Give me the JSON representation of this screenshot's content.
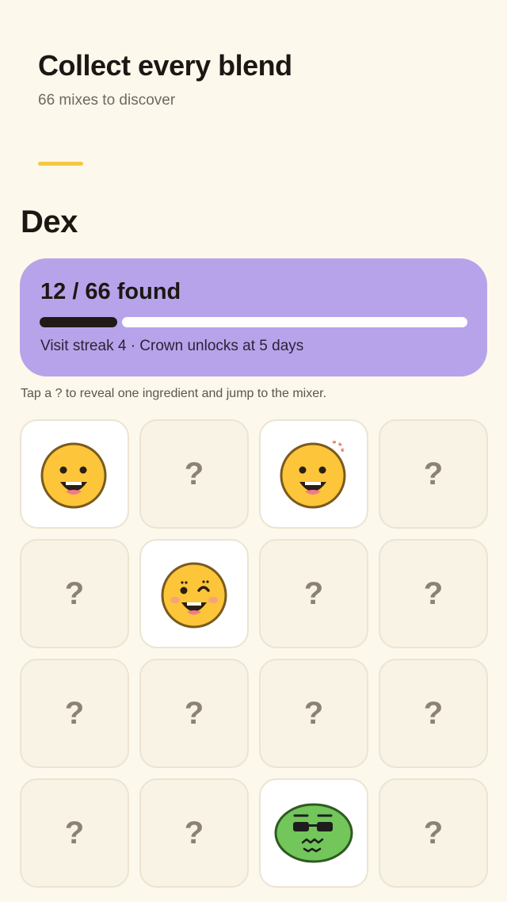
{
  "header": {
    "title": "Collect every blend",
    "subtitle": "66 mixes to discover"
  },
  "section": {
    "title": "Dex"
  },
  "progress": {
    "label": "12 / 66 found",
    "found": 12,
    "total": 66,
    "streak_text": "Visit streak 4 · Crown unlocks at 5 days"
  },
  "hint": "Tap a ? to reveal one ingredient and jump to the mixer.",
  "colors": {
    "background": "#fdf8ec",
    "accent": "#f5c842",
    "card": "#b7a3ea",
    "tile_locked": "#f9f3e6",
    "tile_found": "#ffffff",
    "face_yellow": "#fcc53a",
    "face_green": "#72c65a"
  },
  "tiles": [
    {
      "state": "found",
      "icon": "grinning-face-icon"
    },
    {
      "state": "locked",
      "label": "?"
    },
    {
      "state": "found",
      "icon": "grinning-face-sparkle-icon"
    },
    {
      "state": "locked",
      "label": "?"
    },
    {
      "state": "locked",
      "label": "?"
    },
    {
      "state": "found",
      "icon": "winking-face-icon"
    },
    {
      "state": "locked",
      "label": "?"
    },
    {
      "state": "locked",
      "label": "?"
    },
    {
      "state": "locked",
      "label": "?"
    },
    {
      "state": "locked",
      "label": "?"
    },
    {
      "state": "locked",
      "label": "?"
    },
    {
      "state": "locked",
      "label": "?"
    },
    {
      "state": "locked",
      "label": "?"
    },
    {
      "state": "locked",
      "label": "?"
    },
    {
      "state": "found",
      "icon": "cool-green-face-icon"
    },
    {
      "state": "locked",
      "label": "?"
    }
  ]
}
